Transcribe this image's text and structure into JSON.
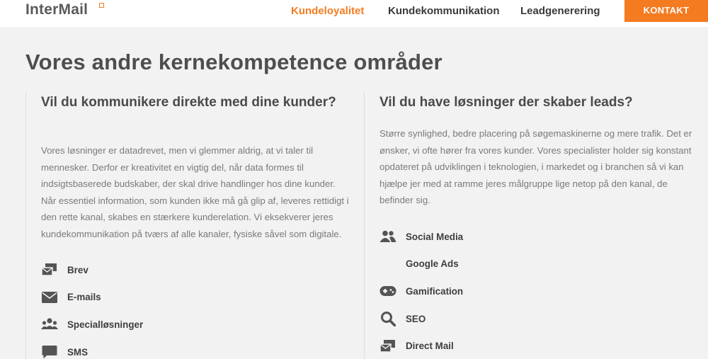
{
  "header": {
    "logo": "InterMail",
    "nav": [
      {
        "label": "Kundeloyalitet",
        "active": true
      },
      {
        "label": "Kundekommunikation",
        "active": false
      },
      {
        "label": "Leadgenerering",
        "active": false
      }
    ],
    "contact_label": "KONTAKT"
  },
  "colors": {
    "accent": "#f47b20",
    "background": "#f2f2f2",
    "text": "#4a4a4a"
  },
  "main": {
    "heading": "Vores andre kernekompetence områder",
    "left": {
      "heading": "Vil du kommunikere direkte med dine kunder?",
      "text": "Vores løsninger er datadrevet, men vi glemmer aldrig, at vi taler til mennesker. Derfor er kreativitet en vigtig del, når data formes til indsigtsbaserede budskaber, der skal drive handlinger hos dine kunder. Når essentiel information, som kunden ikke må gå glip af, leveres rettidigt i den rette kanal, skabes en stærkere kunderelation. Vi eksekverer jeres kundekommunikation på tværs af alle kanaler, fysiske såvel som digitale.",
      "items": [
        {
          "label": "Brev",
          "icon": "mail-stack-icon"
        },
        {
          "label": "E-mails",
          "icon": "envelope-icon"
        },
        {
          "label": "Specialløsninger",
          "icon": "users-icon"
        },
        {
          "label": "SMS",
          "icon": "chat-bubble-icon"
        }
      ]
    },
    "right": {
      "heading": "Vil du have løsninger der skaber leads?",
      "text": "Større synlighed, bedre placering på søgemaskinerne og mere trafik. Det er ønsker, vi ofte hører fra vores kunder. Vores specialister holder sig konstant opdateret på udviklingen i teknologien, i markedet og i branchen så vi kan hjælpe jer med at ramme jeres målgruppe lige netop på den kanal, de befinder sig.",
      "items": [
        {
          "label": "Social Media",
          "icon": "people-icon"
        },
        {
          "label": "Google Ads",
          "icon": ""
        },
        {
          "label": "Gamification",
          "icon": "gamepad-icon"
        },
        {
          "label": "SEO",
          "icon": "search-icon"
        },
        {
          "label": "Direct Mail",
          "icon": "mail-stack-icon"
        }
      ]
    }
  }
}
